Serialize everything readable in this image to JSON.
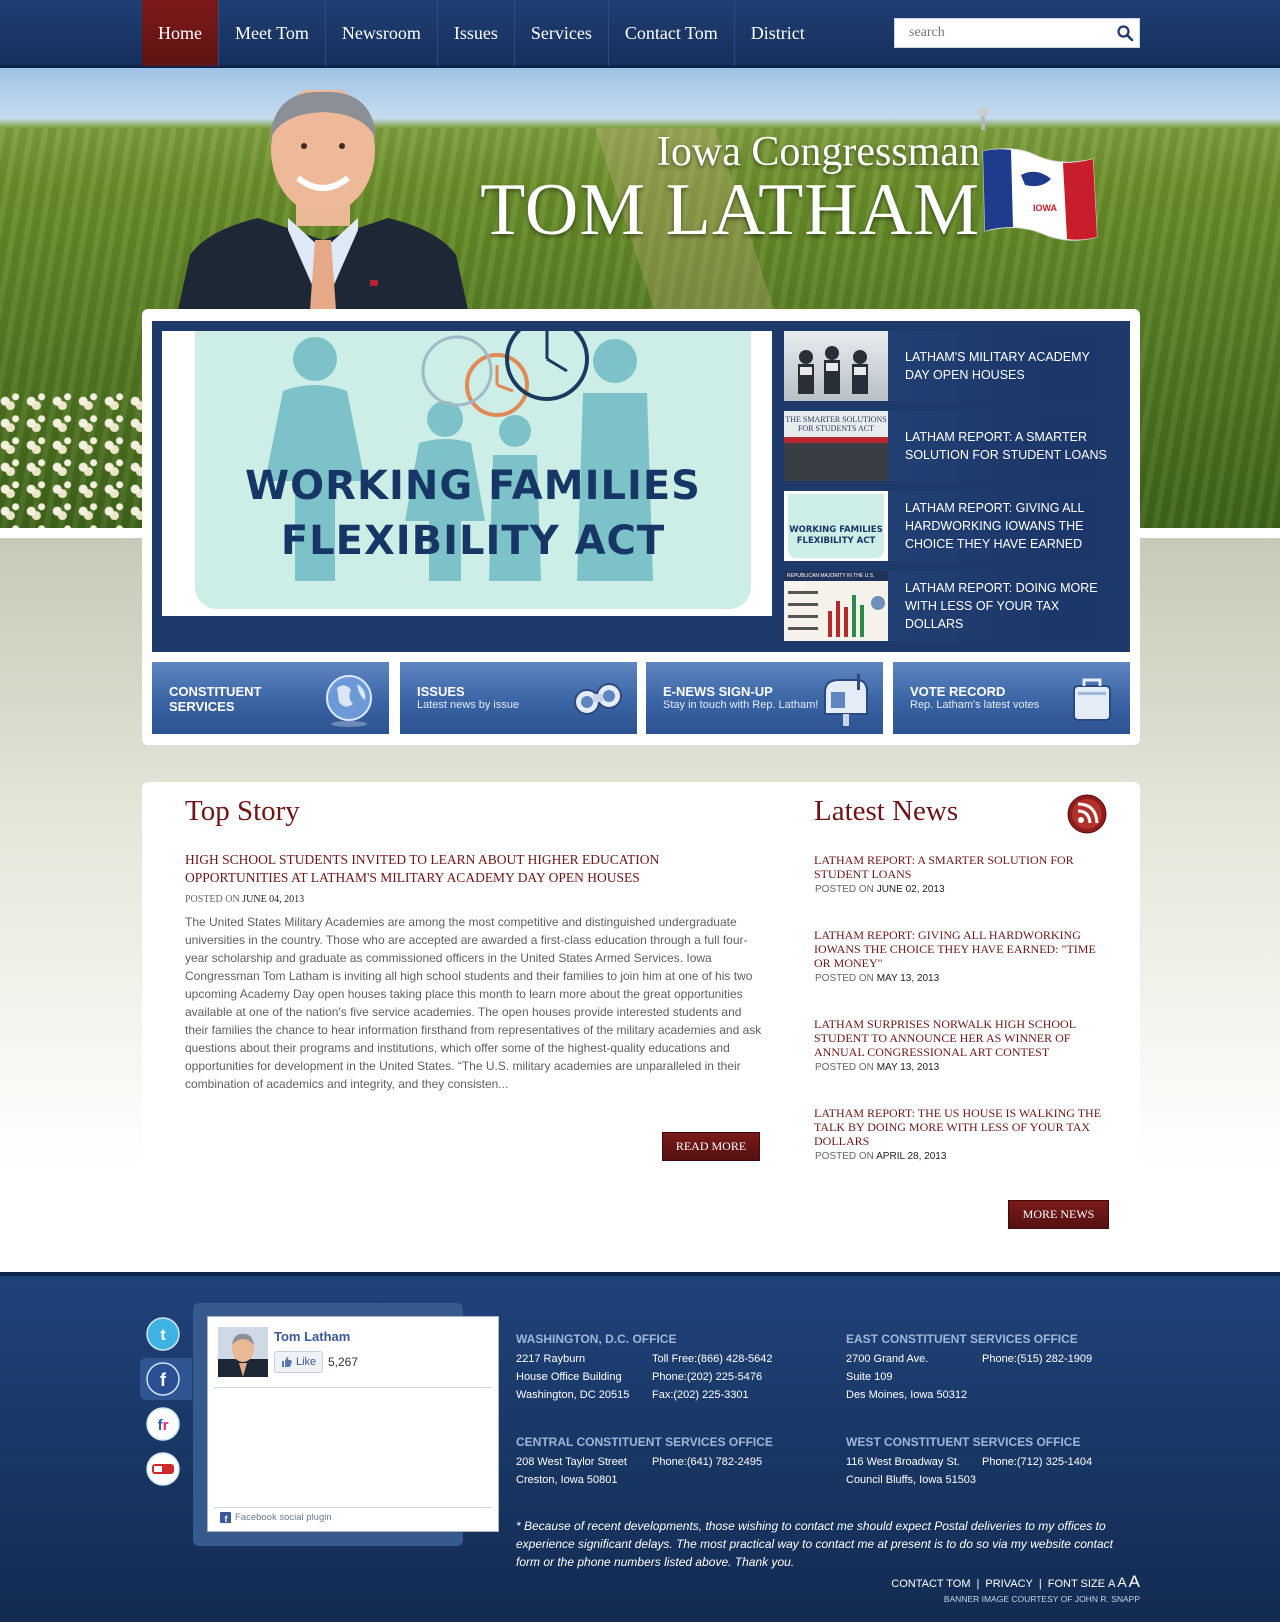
{
  "nav": {
    "items": [
      "Home",
      "Meet Tom",
      "Newsroom",
      "Issues",
      "Services",
      "Contact Tom",
      "District"
    ],
    "active": "Home",
    "search_placeholder": "search"
  },
  "hero": {
    "subtitle": "Iowa Congressman",
    "name": "TOM LATHAM",
    "flag_text": "IOWA"
  },
  "slider": {
    "main_title_line1": "WORKING FAMILIES",
    "main_title_line2": "FLEXIBILITY ACT",
    "items": [
      {
        "label": "LATHAM'S MILITARY ACADEMY DAY OPEN HOUSES"
      },
      {
        "label": "LATHAM REPORT: A SMARTER SOLUTION FOR STUDENT LOANS",
        "thumb_text": "THE SMARTER SOLUTIONS FOR STUDENTS ACT"
      },
      {
        "label": "LATHAM REPORT: GIVING ALL HARDWORKING IOWANS THE CHOICE THEY HAVE EARNED",
        "thumb_text": "WORKING FAMILIES FLEXIBILITY ACT"
      },
      {
        "label": "LATHAM REPORT: DOING MORE WITH LESS OF YOUR TAX DOLLARS",
        "thumb_text": "REPUBLICAN MAJORITY IN THE U.S. HOUSE"
      }
    ]
  },
  "tiles": [
    {
      "title": "CONSTITUENT SERVICES",
      "sub": "",
      "icon": "globe-icon"
    },
    {
      "title": "ISSUES",
      "sub": "Latest news by issue",
      "icon": "binoculars-icon"
    },
    {
      "title": "E-NEWS SIGN-UP",
      "sub": "Stay in touch with Rep. Latham!",
      "icon": "mailbox-icon"
    },
    {
      "title": "VOTE RECORD",
      "sub": "Rep. Latham's latest votes",
      "icon": "briefcase-icon"
    }
  ],
  "top_story": {
    "heading": "Top Story",
    "title": "HIGH SCHOOL STUDENTS INVITED TO LEARN ABOUT HIGHER EDUCATION OPPORTUNITIES AT LATHAM'S MILITARY ACADEMY DAY OPEN HOUSES",
    "posted_label": "POSTED ON",
    "date": "JUNE 04, 2013",
    "body": "The United States Military Academies are among the most competitive and distinguished undergraduate universities in the country. Those who are accepted are awarded a first-class education through a full four-year scholarship and graduate as commissioned officers in the United States Armed Services. Iowa Congressman Tom Latham is inviting all high school students and their families to join him at one of his two upcoming Academy Day open houses taking place this month to learn more about the great opportunities available at one of the nation's five service academies. The open houses provide interested students and their families the chance to hear information firsthand from representatives of the military academies and ask questions about their programs and institutions, which offer some of the highest-quality educations and opportunities for development in the United States. “The U.S. military academies are unparalleled in their combination of academics and integrity, and they consisten...",
    "read_more": "READ MORE"
  },
  "latest_news": {
    "heading": "Latest News",
    "posted_label": "POSTED ON",
    "items": [
      {
        "title": "LATHAM REPORT: A SMARTER SOLUTION FOR STUDENT LOANS",
        "date": "JUNE 02, 2013"
      },
      {
        "title": "LATHAM REPORT: GIVING ALL HARDWORKING IOWANS THE CHOICE THEY HAVE EARNED: \"TIME OR MONEY\"",
        "date": "MAY 13, 2013"
      },
      {
        "title": "LATHAM SURPRISES NORWALK HIGH SCHOOL STUDENT TO ANNOUNCE HER AS WINNER OF ANNUAL CONGRESSIONAL ART CONTEST",
        "date": "MAY 13, 2013"
      },
      {
        "title": "LATHAM REPORT: THE US HOUSE IS WALKING THE TALK BY DOING MORE WITH LESS OF YOUR TAX DOLLARS",
        "date": "APRIL 28, 2013"
      }
    ],
    "more_news": "MORE NEWS"
  },
  "facebook": {
    "name": "Tom Latham",
    "like": "Like",
    "count": "5,267",
    "plugin": "Facebook social plugin"
  },
  "offices": [
    {
      "title": "WASHINGTON, D.C. OFFICE",
      "col1": [
        "2217 Rayburn",
        "House Office Building",
        "Washington, DC 20515"
      ],
      "col2": [
        "Toll Free:(866) 428-5642",
        "Phone:(202) 225-5476",
        "Fax:(202) 225-3301"
      ]
    },
    {
      "title": "EAST CONSTITUENT SERVICES OFFICE",
      "col1": [
        "2700 Grand Ave.",
        "Suite 109",
        "Des Moines, Iowa 50312"
      ],
      "col2": [
        "Phone:(515) 282-1909"
      ]
    },
    {
      "title": "CENTRAL CONSTITUENT SERVICES OFFICE",
      "col1": [
        "208 West Taylor Street",
        "Creston, Iowa 50801"
      ],
      "col2": [
        "Phone:(641) 782-2495"
      ]
    },
    {
      "title": "WEST CONSTITUENT SERVICES OFFICE",
      "col1": [
        "116 West Broadway St.",
        "Council Bluffs, Iowa 51503"
      ],
      "col2": [
        "Phone:(712) 325-1404"
      ]
    }
  ],
  "note": "* Because of recent developments, those wishing to contact me should expect Postal deliveries to my offices to experience significant delays. The most practical way to contact me at present is to do so via my website contact form or the phone numbers listed above. Thank you.",
  "footer_links": {
    "contact": "CONTACT TOM",
    "privacy": "PRIVACY",
    "font_size": "FONT SIZE",
    "a_small": "A",
    "a_med": "A",
    "a_large": "A",
    "credit": "BANNER IMAGE COURTESY OF JOHN R. SNAPP"
  },
  "colors": {
    "navy": "#1d3a6b",
    "maroon": "#6e1515",
    "tile_blue": "#3a64a4"
  }
}
